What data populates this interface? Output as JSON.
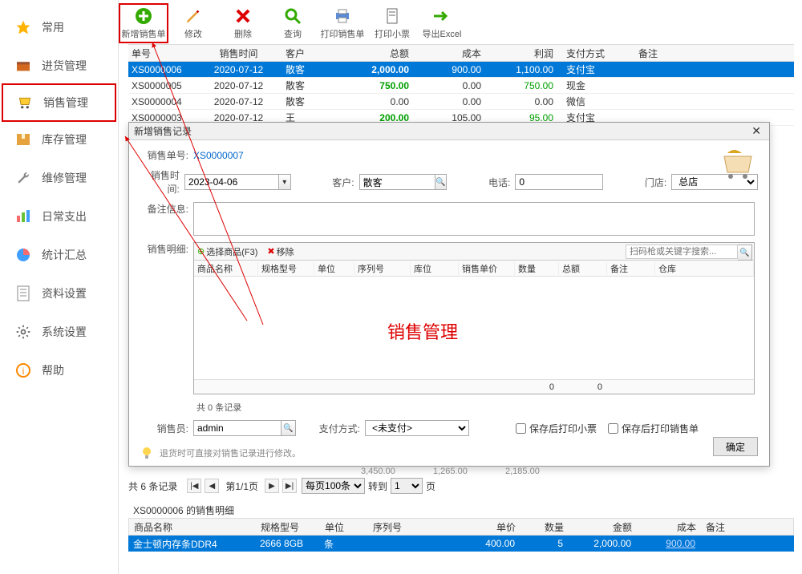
{
  "sidebar": {
    "items": [
      {
        "label": "常用",
        "icon": "star"
      },
      {
        "label": "进货管理",
        "icon": "box-in"
      },
      {
        "label": "销售管理",
        "icon": "cart"
      },
      {
        "label": "库存管理",
        "icon": "package"
      },
      {
        "label": "维修管理",
        "icon": "wrench"
      },
      {
        "label": "日常支出",
        "icon": "chart"
      },
      {
        "label": "统计汇总",
        "icon": "pie"
      },
      {
        "label": "资料设置",
        "icon": "doc"
      },
      {
        "label": "系统设置",
        "icon": "gear"
      },
      {
        "label": "帮助",
        "icon": "info"
      }
    ]
  },
  "toolbar": {
    "items": [
      {
        "label": "新增销售单"
      },
      {
        "label": "修改"
      },
      {
        "label": "删除"
      },
      {
        "label": "查询"
      },
      {
        "label": "打印销售单"
      },
      {
        "label": "打印小票"
      },
      {
        "label": "导出Excel"
      }
    ]
  },
  "table": {
    "headers": {
      "id": "单号",
      "date": "销售时间",
      "cust": "客户",
      "amt": "总额",
      "cost": "成本",
      "profit": "利润",
      "pay": "支付方式",
      "note": "备注"
    },
    "rows": [
      {
        "id": "XS0000006",
        "date": "2020-07-12",
        "cust": "散客",
        "amt": "2,000.00",
        "cost": "900.00",
        "profit": "1,100.00",
        "pay": "支付宝",
        "selected": true
      },
      {
        "id": "XS0000005",
        "date": "2020-07-12",
        "cust": "散客",
        "amt": "750.00",
        "cost": "0.00",
        "profit": "750.00",
        "pay": "现金"
      },
      {
        "id": "XS0000004",
        "date": "2020-07-12",
        "cust": "散客",
        "amt": "0.00",
        "cost": "0.00",
        "profit": "0.00",
        "pay": "微信"
      },
      {
        "id": "XS0000003",
        "date": "2020-07-12",
        "cust": "王",
        "amt": "200.00",
        "cost": "105.00",
        "profit": "95.00",
        "pay": "支付宝"
      }
    ]
  },
  "dialog": {
    "title": "新增销售记录",
    "labels": {
      "order_no": "销售单号:",
      "order_val": "XS0000007",
      "time": "销售时间:",
      "date_val": "2023-04-06",
      "cust": "客户:",
      "cust_val": "散客",
      "phone": "电话:",
      "phone_val": "0",
      "store": "门店:",
      "store_val": "总店",
      "remark": "备注信息:",
      "detail": "销售明细:",
      "select_product": "选择商品(F3)",
      "remove": "移除",
      "search_placeholder": "扫码枪或关键字搜索...",
      "record_count": "共 0 条记录",
      "salesman": "销售员:",
      "salesman_val": "admin",
      "paymethod": "支付方式:",
      "paymethod_val": "<未支付>",
      "chk_receipt": "保存后打印小票",
      "chk_order": "保存后打印销售单",
      "confirm": "确定",
      "hint": "退货时可直接对销售记录进行修改。"
    },
    "detail_headers": [
      "商品名称",
      "规格型号",
      "单位",
      "序列号",
      "库位",
      "销售单价",
      "数量",
      "总额",
      "备注",
      "仓库"
    ],
    "detail_footer_zeros": [
      "0",
      "0"
    ]
  },
  "annotation_text": "销售管理",
  "footer": {
    "hidden_totals": [
      "3,450.00",
      "1,265.00",
      "2,185.00"
    ],
    "pager_count": "共 6 条记录",
    "pager_page": "第1/1页",
    "per_page": "每页100条",
    "goto_label": "转到",
    "goto_val": "1",
    "goto_suffix": "页",
    "detail_title": "XS0000006 的销售明细"
  },
  "bottom_table": {
    "headers": {
      "name": "商品名称",
      "spec": "规格型号",
      "unit": "单位",
      "serial": "序列号",
      "price": "单价",
      "qty": "数量",
      "amt": "金额",
      "cost": "成本",
      "note": "备注"
    },
    "row": {
      "name": "金士顿内存条DDR4",
      "spec": "2666 8GB",
      "unit": "条",
      "serial": "",
      "price": "400.00",
      "qty": "5",
      "amt": "2,000.00",
      "cost": "900.00",
      "note": ""
    }
  }
}
